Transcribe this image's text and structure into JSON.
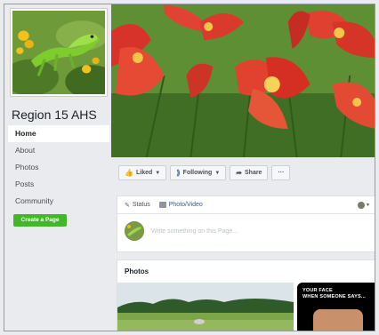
{
  "page": {
    "name": "Region 15 AHS"
  },
  "nav": {
    "items": [
      "Home",
      "About",
      "Photos",
      "Posts",
      "Community"
    ]
  },
  "create_page_label": "Create a Page",
  "actions": {
    "liked_label": "Liked",
    "following_label": "Following",
    "share_label": "Share",
    "more_label": "···"
  },
  "composer": {
    "status_label": "Status",
    "photo_video_label": "Photo/Video",
    "placeholder": "Write something on this Page..."
  },
  "photos": {
    "title": "Photos",
    "meme_text_line1": "YOUR FACE",
    "meme_text_line2": "WHEN SOMEONE SAYS..."
  },
  "colors": {
    "accent_blue": "#365899",
    "create_green": "#42b72a"
  }
}
